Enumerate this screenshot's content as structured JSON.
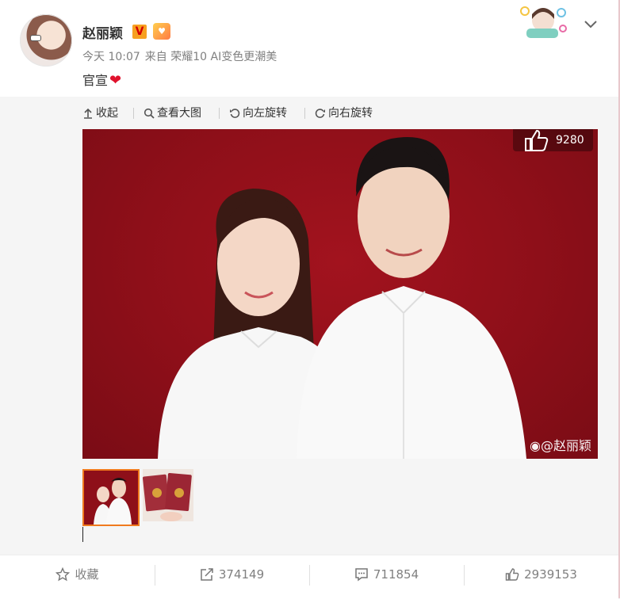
{
  "post": {
    "author": "赵丽颖",
    "verified_badge": "V",
    "time": "今天 10:07",
    "source": "来自 荣耀10 AI变色更潮美",
    "content": "官宣",
    "heart": "❤"
  },
  "toolbar": {
    "collapse": "收起",
    "view_large": "查看大图",
    "rotate_left": "向左旋转",
    "rotate_right": "向右旋转"
  },
  "photo": {
    "likes": "9280",
    "watermark": "@赵丽颖"
  },
  "actions": {
    "favorite": "收藏",
    "repost": "374149",
    "comment": "711854",
    "like": "2939153"
  },
  "colors": {
    "accent": "#f07a1e",
    "photo_bg": "#8e0f19",
    "heart": "#e0122d",
    "meta_text": "#808080"
  },
  "icons": {
    "collapse": "arrow-up-icon",
    "view_large": "search-icon",
    "rotate_left": "rotate-left-icon",
    "rotate_right": "rotate-right-icon",
    "favorite": "star-icon",
    "repost": "share-icon",
    "comment": "comment-icon",
    "like": "thumbs-up-icon",
    "menu": "chevron-down-icon"
  }
}
